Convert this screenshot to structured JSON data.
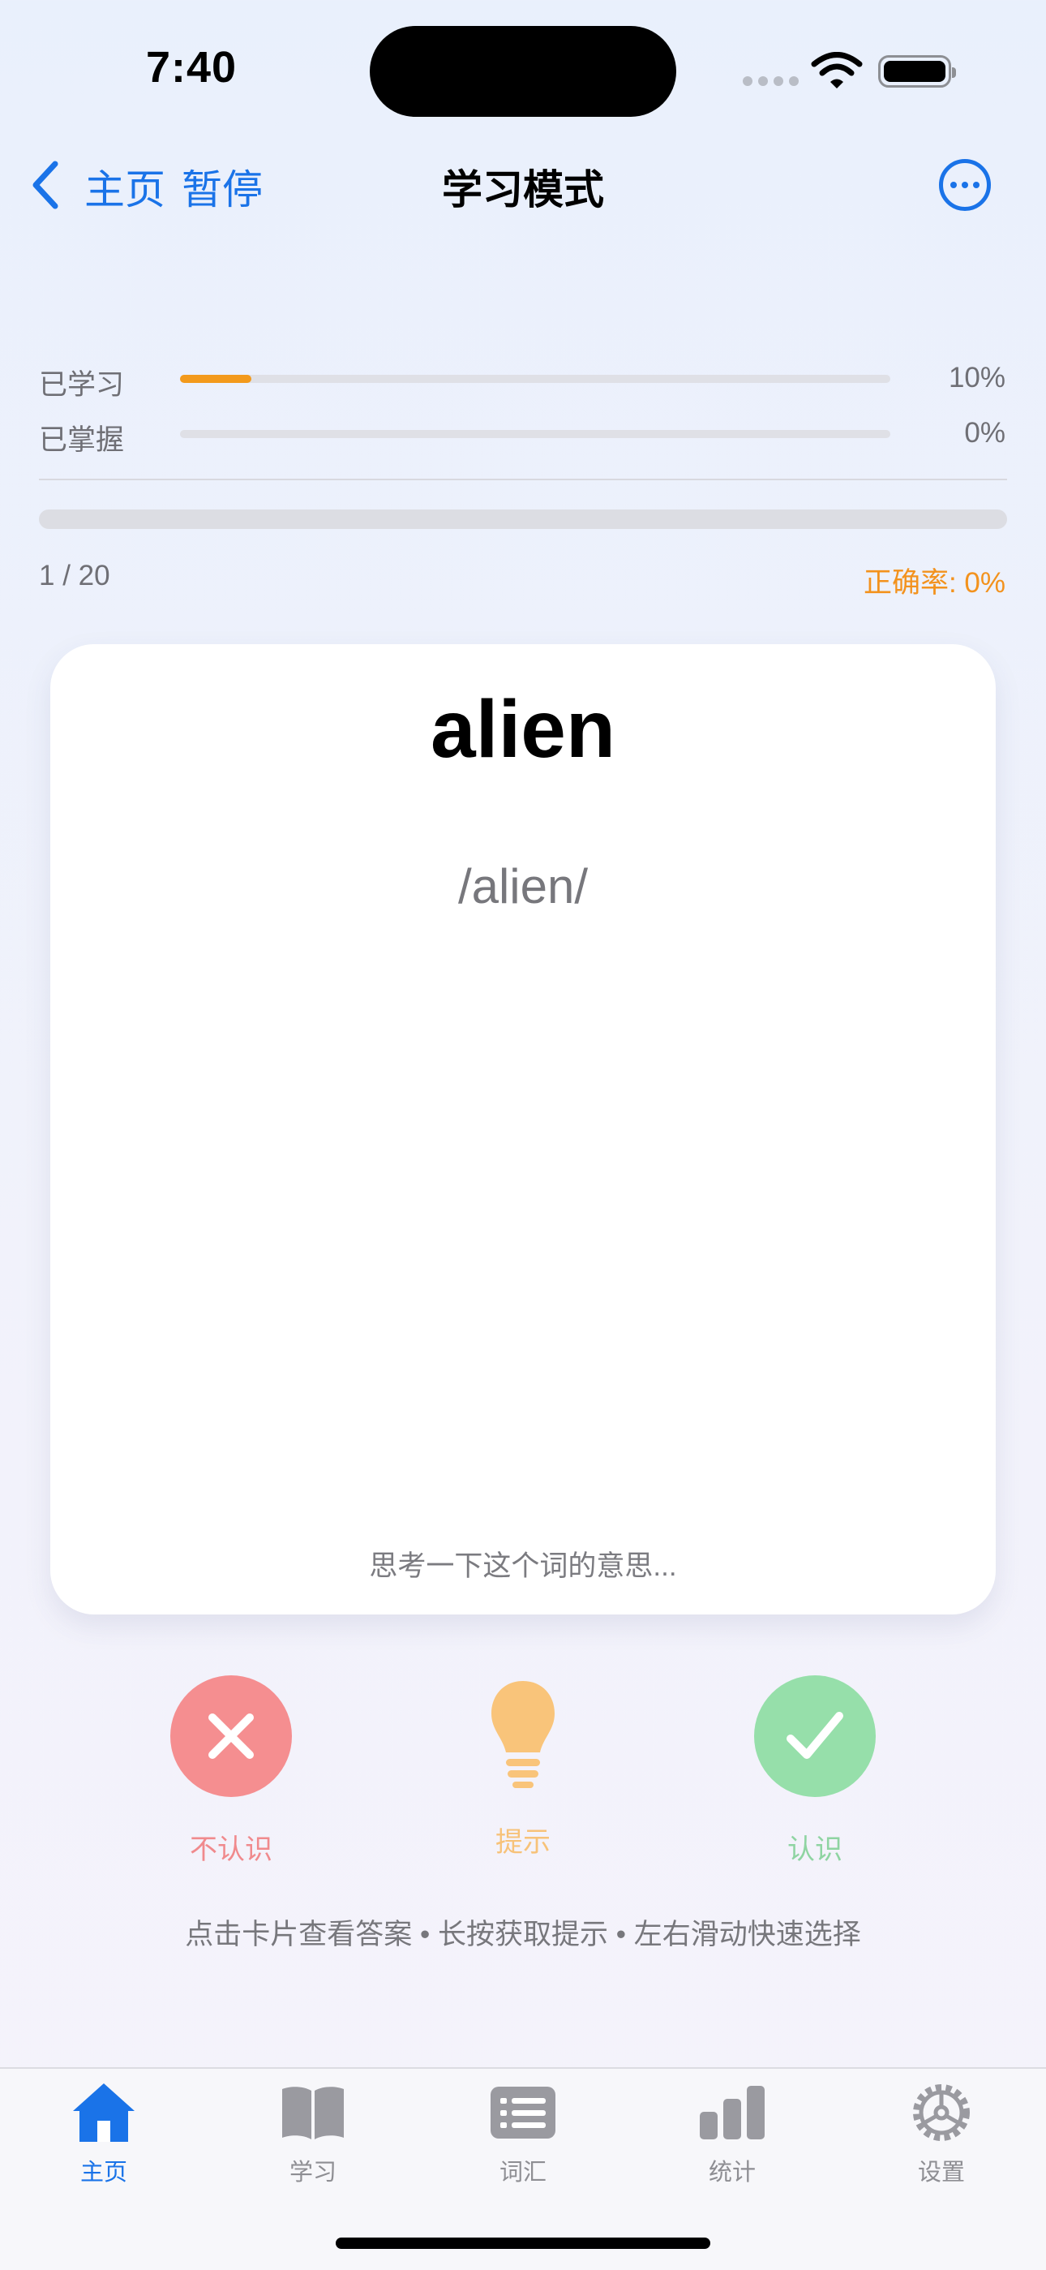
{
  "status_bar": {
    "time": "7:40"
  },
  "nav": {
    "back_label": "主页",
    "pause_label": "暂停",
    "title": "学习模式",
    "more_icon": "ellipsis-circle-icon"
  },
  "progress": {
    "learned": {
      "label": "已学习",
      "percent": 10,
      "percent_text": "10%"
    },
    "mastered": {
      "label": "已掌握",
      "percent": 0,
      "percent_text": "0%"
    },
    "count": "1 / 20",
    "accuracy": "正确率: 0%"
  },
  "card": {
    "word": "alien",
    "phonetic": "/alien/",
    "hint": "思考一下这个词的意思..."
  },
  "actions": {
    "unknown_label": "不认识",
    "hint_label": "提示",
    "known_label": "认识",
    "gesture_hint": "点击卡片查看答案 • 长按获取提示 • 左右滑动快速选择"
  },
  "tabs": [
    {
      "label": "主页",
      "icon": "house-icon",
      "active": true
    },
    {
      "label": "学习",
      "icon": "book-icon",
      "active": false
    },
    {
      "label": "词汇",
      "icon": "list-icon",
      "active": false
    },
    {
      "label": "统计",
      "icon": "bar-chart-icon",
      "active": false
    },
    {
      "label": "设置",
      "icon": "gear-icon",
      "active": false
    }
  ],
  "colors": {
    "accent": "#1a73e8",
    "progress": "#f39a1c",
    "wrong": "#f58e90",
    "hint": "#f9c47a",
    "right": "#96dfaa"
  }
}
